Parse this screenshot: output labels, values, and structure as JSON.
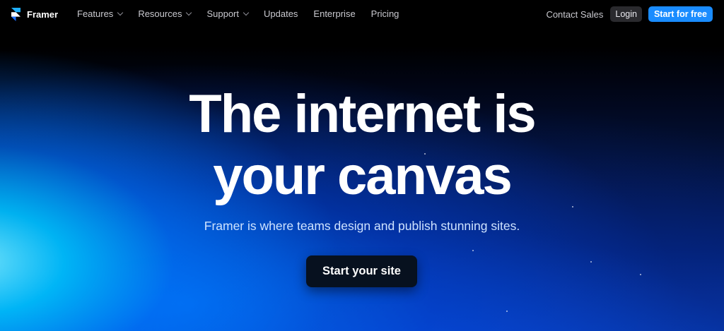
{
  "brand": {
    "name": "Framer",
    "icon": "framer-logo-icon"
  },
  "nav": {
    "items": [
      {
        "label": "Features",
        "has_dropdown": true
      },
      {
        "label": "Resources",
        "has_dropdown": true
      },
      {
        "label": "Support",
        "has_dropdown": true
      },
      {
        "label": "Updates",
        "has_dropdown": false
      },
      {
        "label": "Enterprise",
        "has_dropdown": false
      },
      {
        "label": "Pricing",
        "has_dropdown": false
      }
    ],
    "contact_label": "Contact Sales",
    "login_label": "Login",
    "start_free_label": "Start for free"
  },
  "hero": {
    "title_line1": "The internet is",
    "title_line2": "your canvas",
    "subtitle": "Framer is where teams design and publish stunning sites.",
    "cta_label": "Start your site"
  },
  "colors": {
    "accent": "#1a8cff",
    "background": "#000000",
    "glow": "#00c8ff"
  }
}
